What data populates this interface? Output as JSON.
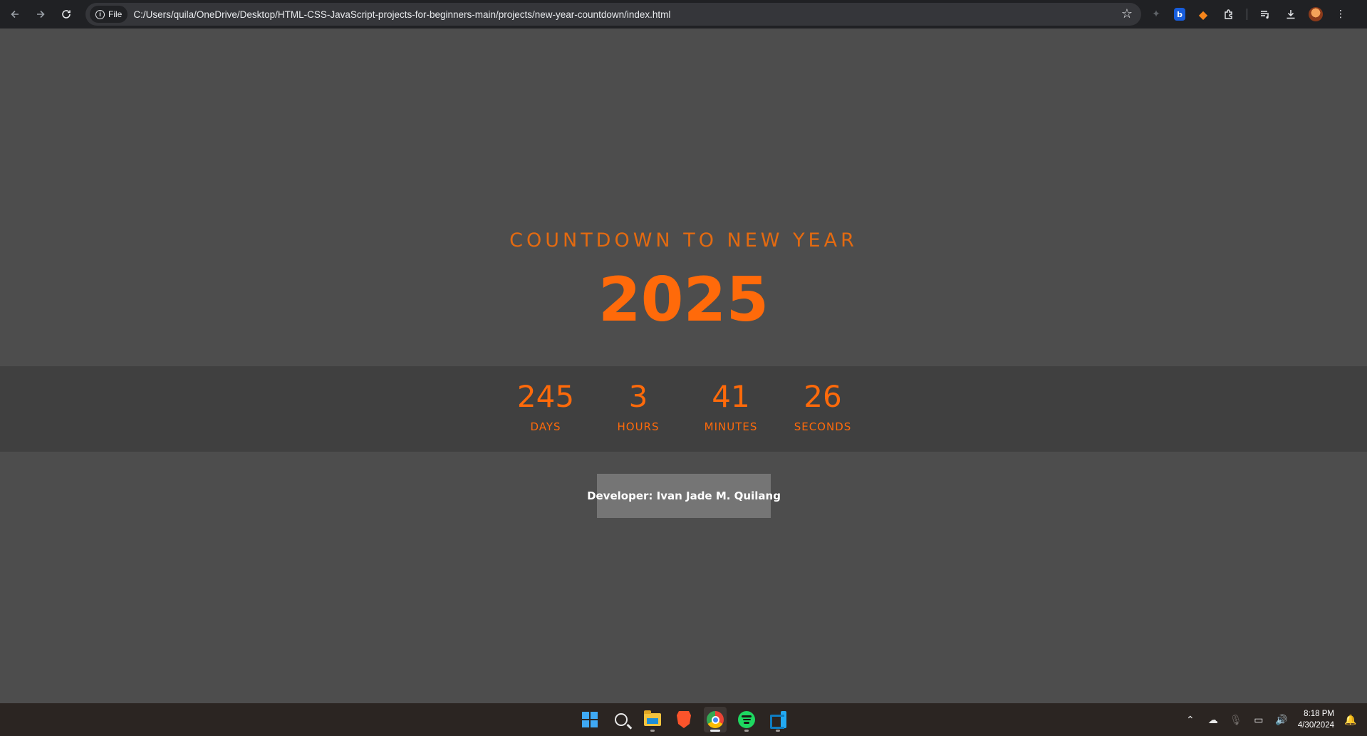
{
  "browser": {
    "file_label": "File",
    "url": "C:/Users/quila/OneDrive/Desktop/HTML-CSS-JavaScript-projects-for-beginners-main/projects/new-year-countdown/index.html",
    "icons": [
      "back-arrow-icon",
      "forward-arrow-icon",
      "reload-icon",
      "info-icon",
      "star-icon",
      "extension-icons",
      "puzzle-icon",
      "media-icon",
      "download-icon",
      "profile-avatar",
      "kebab-menu-icon"
    ]
  },
  "page": {
    "heading": "COUNTDOWN TO NEW YEAR",
    "year": "2025",
    "countdown": [
      {
        "value": "245",
        "label": "DAYS"
      },
      {
        "value": "3",
        "label": "HOURS"
      },
      {
        "value": "41",
        "label": "MINUTES"
      },
      {
        "value": "26",
        "label": "SECONDS"
      }
    ],
    "developer": "Developer: Ivan Jade M. Quilang",
    "colors": {
      "accent": "#ff6a0a",
      "background": "#4d4d4d",
      "band": "#404040",
      "dev_box": "#757575"
    }
  },
  "taskbar": {
    "apps": [
      "start-icon",
      "search-icon",
      "file-explorer-icon",
      "brave-icon",
      "chrome-icon",
      "spotify-icon",
      "vscode-icon"
    ],
    "time": "8:18 PM",
    "date": "4/30/2024"
  }
}
